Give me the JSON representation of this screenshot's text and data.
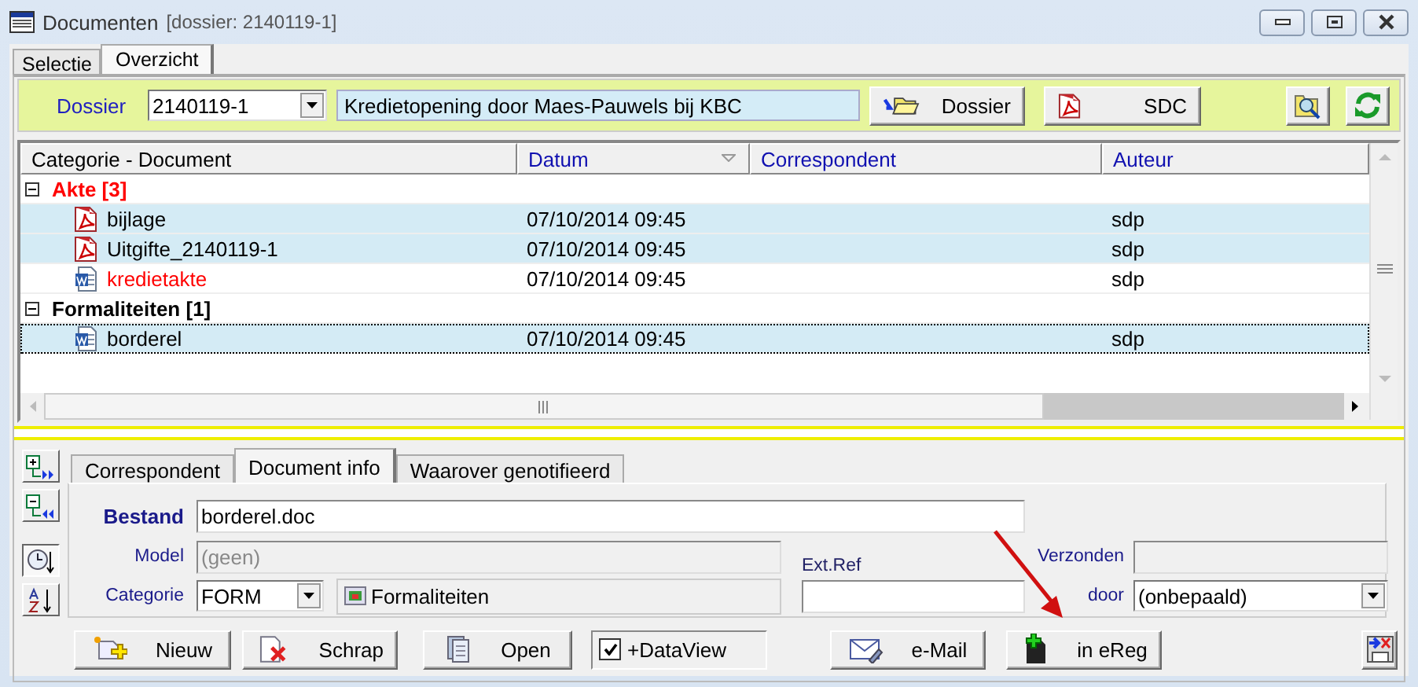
{
  "window": {
    "title": "Documenten",
    "subtitle": "[dossier: 2140119-1]"
  },
  "tabs": [
    {
      "label": "Selectie",
      "selected": false
    },
    {
      "label": "Overzicht",
      "selected": true
    }
  ],
  "dossier_bar": {
    "label": "Dossier",
    "dossier": "2140119-1",
    "description": "Kredietopening door Maes-Pauwels bij KBC",
    "buttons": [
      {
        "label": "Dossier",
        "kind": "folder"
      },
      {
        "label": "SDC",
        "kind": "pdf"
      }
    ]
  },
  "table": {
    "columns": [
      "Categorie - Document",
      "Datum",
      "Correspondent",
      "Auteur"
    ],
    "groups": [
      {
        "name": "Akte [3]",
        "color": "#ff0000",
        "expanded": true,
        "children": [
          {
            "name": "bijlage",
            "kind": "pdf",
            "date": "07/10/2014 09:45",
            "author": "sdp",
            "selected": true,
            "color": "#000000"
          },
          {
            "name": "Uitgifte_2140119-1",
            "kind": "pdf",
            "date": "07/10/2014 09:45",
            "author": "sdp",
            "selected": true,
            "color": "#000000"
          },
          {
            "name": "kredietakte",
            "kind": "word",
            "date": "07/10/2014 09:45",
            "author": "sdp",
            "selected": false,
            "color": "#ff0000"
          }
        ]
      },
      {
        "name": "Formaliteiten [1]",
        "color": "#000000",
        "expanded": true,
        "children": [
          {
            "name": "borderel",
            "kind": "word",
            "date": "07/10/2014 09:45",
            "author": "sdp",
            "selected": true,
            "color": "#000000"
          }
        ]
      }
    ]
  },
  "side_tools": [
    {
      "kind": "expand",
      "pressed": false
    },
    {
      "kind": "collapse",
      "pressed": false
    },
    {
      "kind": "clock",
      "pressed": true
    },
    {
      "kind": "az",
      "pressed": false
    }
  ],
  "detail_tabs": [
    {
      "label": "Correspondent",
      "selected": false
    },
    {
      "label": "Document info",
      "selected": true
    },
    {
      "label": "Waarover genotifieerd",
      "selected": false
    }
  ],
  "document_info": {
    "bestand": {
      "label": "Bestand",
      "value": "borderel.doc"
    },
    "model": {
      "label": "Model",
      "value": "(geen)",
      "disabled": true
    },
    "categorie": {
      "label": "Categorie",
      "value": "FORM",
      "name": "Formaliteiten"
    },
    "ext_ref": {
      "label": "Ext.Ref"
    },
    "verzonden": {
      "label": "Verzonden",
      "disabled": true
    },
    "door": {
      "label": "door",
      "value": "(onbepaald)"
    }
  },
  "buttons": [
    {
      "label": "Nieuw",
      "kind": "new"
    },
    {
      "label": "Schrap",
      "kind": "delete"
    },
    {
      "label": "Open",
      "kind": "open"
    }
  ],
  "dataview": {
    "label": "+DataView",
    "checked": true
  },
  "buttons_right": [
    {
      "label": "e-Mail",
      "kind": "mail"
    },
    {
      "label": "in eReg",
      "kind": "ereg"
    }
  ]
}
